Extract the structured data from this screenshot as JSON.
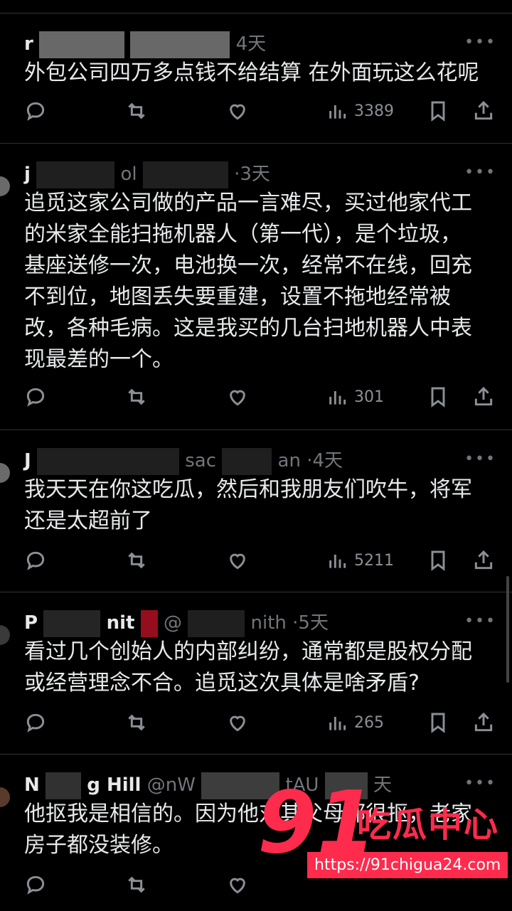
{
  "tweets": [
    {
      "name_visible": "r",
      "time": "4天",
      "lines": [
        "外包公司四万多点钱不给结算 在外面玩这么花呢"
      ],
      "views": "3389"
    },
    {
      "name_visible": "j",
      "handle_visible": "ol",
      "time": "·3天",
      "lines": [
        "追觅这家公司做的产品一言难尽，买过他家代工",
        "的米家全能扫拖机器人（第一代），是个垃圾，",
        "基座送修一次，电池换一次，经常不在线，回充",
        "不到位，地图丢失要重建，设置不拖地经常被",
        "改，各种毛病。这是我买的几台扫地机器人中表",
        "现最差的一个。"
      ],
      "views": "301"
    },
    {
      "name_visible": "J",
      "handle_visible": "sac",
      "handle_end": "an",
      "time": "·4天",
      "lines": [
        "我天天在你这吃瓜，然后和我朋友们吹牛，将军",
        "还是太超前了"
      ],
      "views": "5211"
    },
    {
      "name_visible": "P",
      "name_end": "nit",
      "handle_visible": "@",
      "handle_end": "nith",
      "time": "·5天",
      "lines": [
        "看过几个创始人的内部纠纷，通常都是股权分配",
        "或经营理念不合。追觅这次具体是啥矛盾?"
      ],
      "views": "265"
    },
    {
      "name_visible": "N",
      "name_end": "g Hill",
      "handle_visible": "@nW",
      "handle_end": "tAU",
      "time": "天",
      "lines": [
        "他抠我是相信的。因为他对其父母都很抠，老家",
        "房子都没装修。"
      ],
      "views": ""
    }
  ],
  "more_glyph": "•••",
  "watermark": {
    "number": "91",
    "title": "吃瓜中心",
    "url": "https://91chigua24.com"
  },
  "icons": [
    "reply-icon",
    "retweet-icon",
    "like-icon",
    "views-icon",
    "bookmark-icon",
    "share-icon"
  ]
}
